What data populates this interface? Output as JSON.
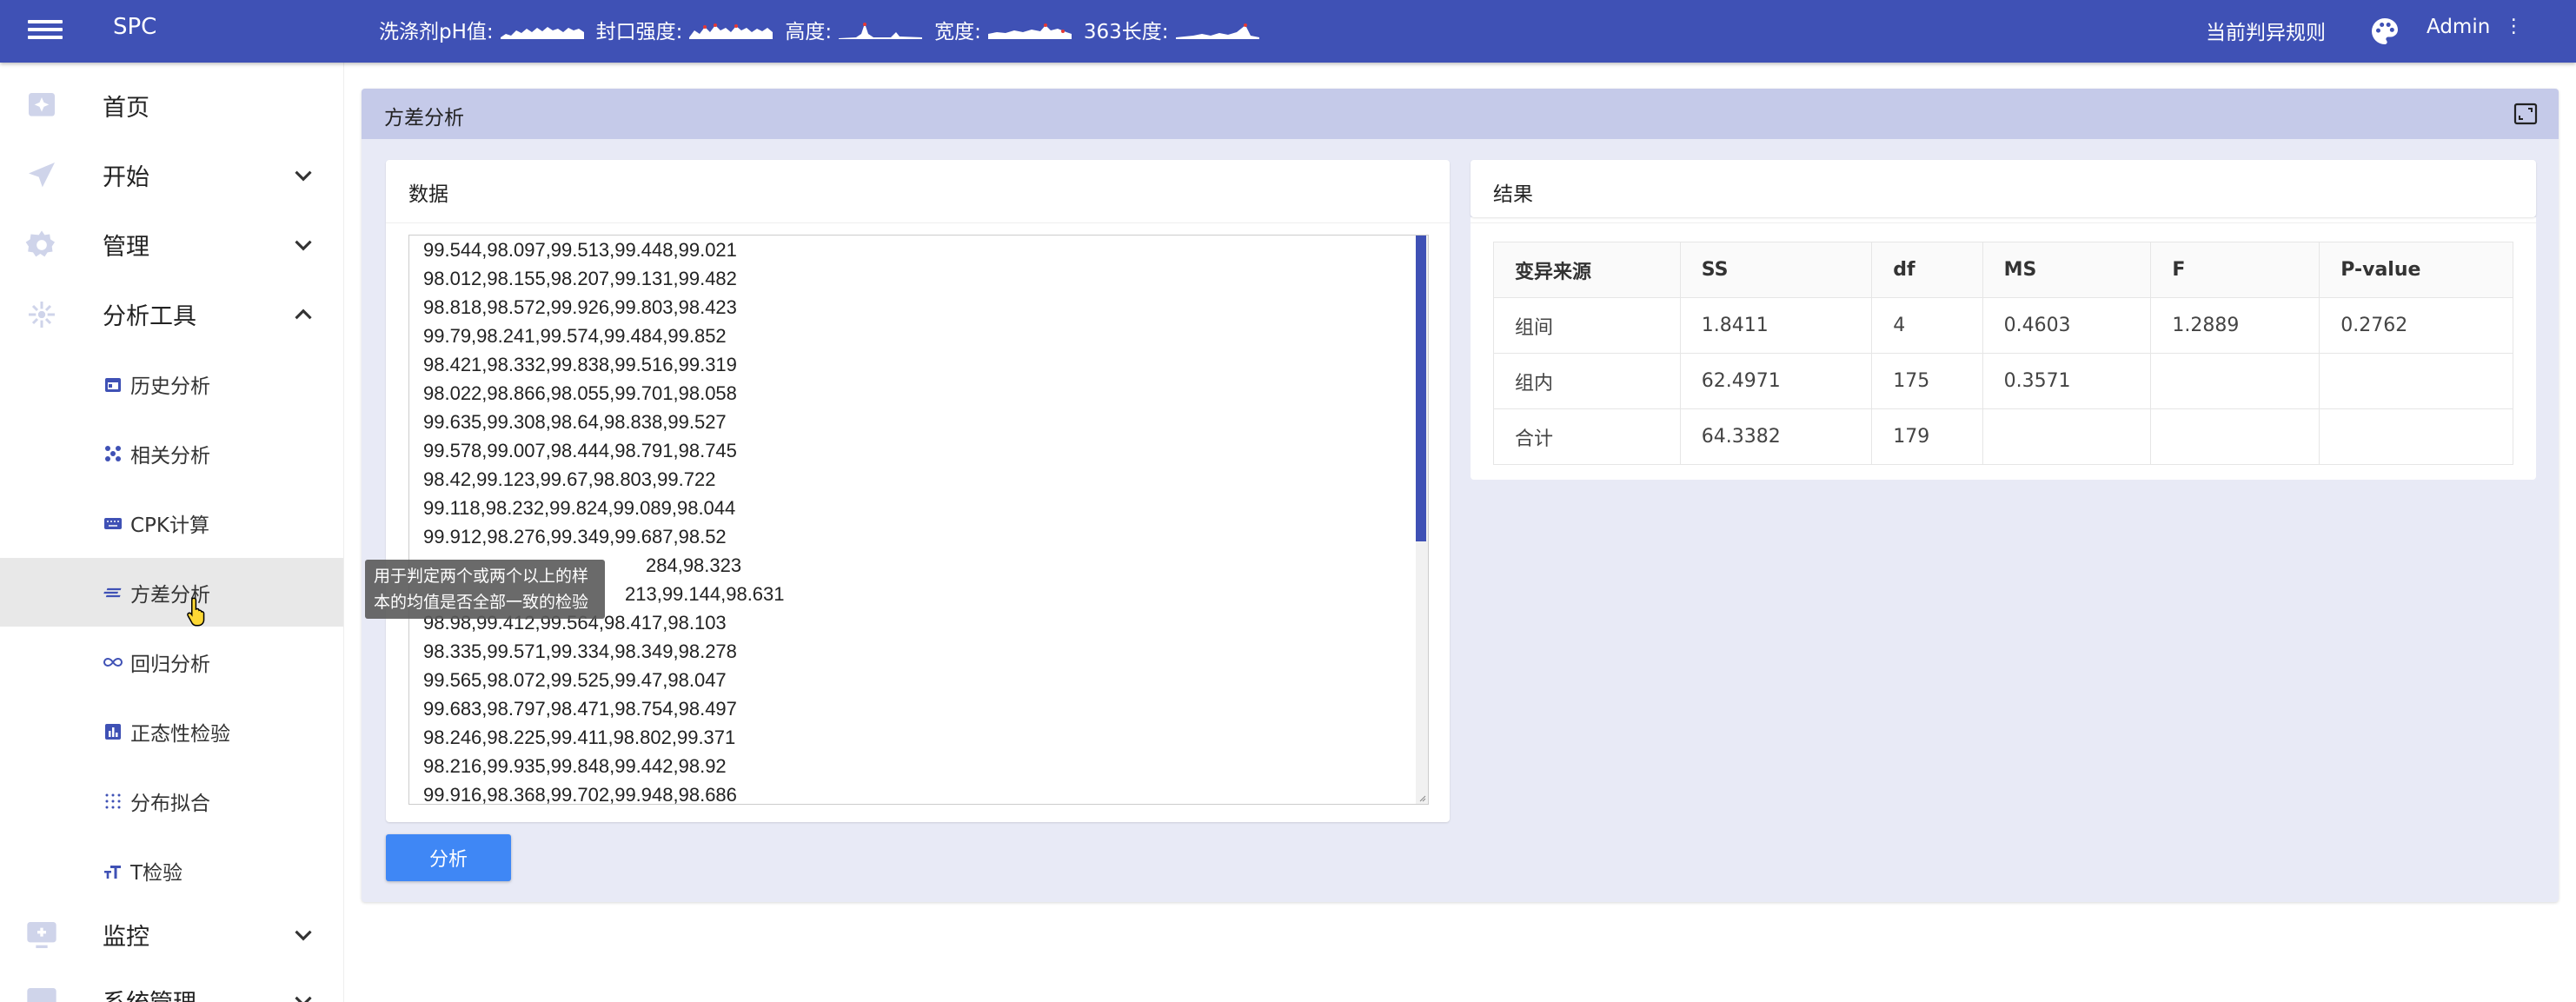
{
  "topbar": {
    "app_title": "SPC",
    "ticker": [
      {
        "label": "洗涤剂pH值:"
      },
      {
        "label": "封口强度:"
      },
      {
        "label": "高度:"
      },
      {
        "label": "宽度:"
      },
      {
        "label": "363长度:"
      }
    ],
    "rules_link": "当前判异规则",
    "user": "Admin",
    "user_menu_icon": "⋮",
    "colors": {
      "bar": "#3f51b5",
      "spark_fill": "#ffffff",
      "spark_alert": "#e53935"
    }
  },
  "sidebar": {
    "items": [
      {
        "label": "首页",
        "icon": "home-icon"
      },
      {
        "label": "开始",
        "icon": "send-icon"
      },
      {
        "label": "管理",
        "icon": "gear-icon"
      },
      {
        "label": "分析工具",
        "icon": "analysis-icon"
      },
      {
        "label": "监控",
        "icon": "monitor-icon"
      },
      {
        "label": "系统管理",
        "icon": "system-icon"
      }
    ],
    "sub_items": [
      {
        "label": "历史分析",
        "icon": "calendar-icon"
      },
      {
        "label": "相关分析",
        "icon": "scatter-icon"
      },
      {
        "label": "CPK计算",
        "icon": "keyboard-icon"
      },
      {
        "label": "方差分析",
        "icon": "variance-icon"
      },
      {
        "label": "回归分析",
        "icon": "infinity-icon"
      },
      {
        "label": "正态性检验",
        "icon": "bar-chart-icon"
      },
      {
        "label": "分布拟合",
        "icon": "grid-dots-icon"
      },
      {
        "label": "T检验",
        "icon": "text-size-icon"
      }
    ],
    "active_sub": "方差分析",
    "tooltip": "用于判定两个或两个以上的样本的均值是否全部一致的检验"
  },
  "panel": {
    "title": "方差分析"
  },
  "data_card": {
    "title": "数据",
    "lines": [
      "99.544,98.097,99.513,99.448,99.021",
      "98.012,98.155,98.207,99.131,99.482",
      "98.818,98.572,99.926,99.803,98.423",
      "99.79,98.241,99.574,99.484,99.852",
      "98.421,98.332,99.838,99.516,99.319",
      "98.022,98.866,98.055,99.701,98.058",
      "99.635,99.308,98.64,98.838,99.527",
      "99.578,99.007,98.444,98.791,98.745",
      "98.42,99.123,99.67,98.803,99.722",
      "99.118,98.232,99.824,99.089,98.044",
      "99.912,98.276,99.349,99.687,98.52",
      "284,98.323",
      "213,99.144,98.631",
      "98.98,99.412,99.564,98.417,98.103",
      "98.335,99.571,99.334,98.349,98.278",
      "99.565,98.072,99.525,99.47,98.047",
      "99.683,98.797,98.471,98.754,98.497",
      "98.246,98.225,99.411,98.802,99.371",
      "98.216,99.935,99.848,99.442,98.92",
      "99.916,98.368,99.702,99.948,98.686"
    ],
    "button": "分析"
  },
  "result_card": {
    "title": "结果",
    "headers": [
      "变异来源",
      "SS",
      "df",
      "MS",
      "F",
      "P-value"
    ],
    "rows": [
      [
        "组间",
        "1.8411",
        "4",
        "0.4603",
        "1.2889",
        "0.2762"
      ],
      [
        "组内",
        "62.4971",
        "175",
        "0.3571",
        "",
        ""
      ],
      [
        "合计",
        "64.3382",
        "179",
        "",
        "",
        ""
      ]
    ]
  }
}
